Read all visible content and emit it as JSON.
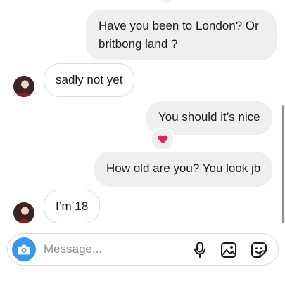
{
  "messages": [
    {
      "text": "Have you been to London? Or britbong land ?",
      "direction": "outgoing"
    },
    {
      "text": "sadly not yet",
      "direction": "incoming"
    },
    {
      "text": "You should it’s nice",
      "direction": "outgoing",
      "reaction": "❤️"
    },
    {
      "text": "How old are you? You look jb",
      "direction": "outgoing"
    },
    {
      "text": "I’m 18",
      "direction": "incoming"
    }
  ],
  "composer": {
    "placeholder": "Message...",
    "value": "",
    "icons": [
      "camera-icon",
      "microphone-icon",
      "gallery-icon",
      "sticker-icon"
    ]
  },
  "colors": {
    "accent": "#3797f0",
    "outgoing_bubble": "#efefef",
    "incoming_border": "#dcdcdc",
    "heart": "#e0245e"
  }
}
